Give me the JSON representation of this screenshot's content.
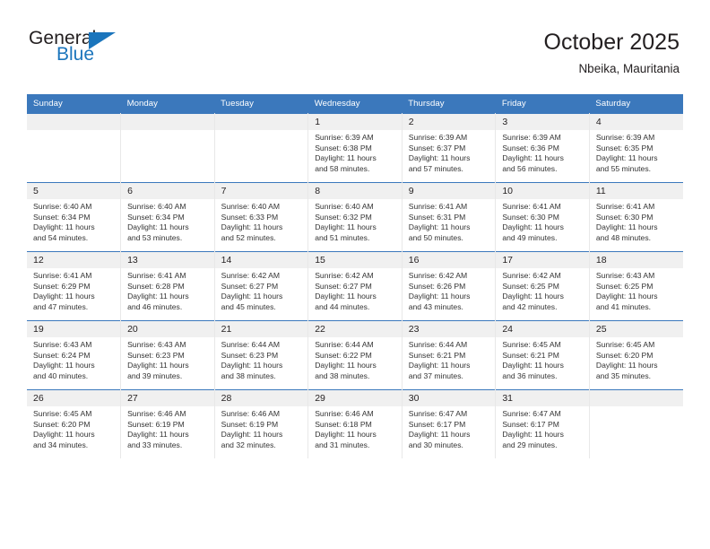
{
  "brand": {
    "name_top": "General",
    "name_bottom": "Blue"
  },
  "header": {
    "title": "October 2025",
    "subtitle": "Nbeika, Mauritania"
  },
  "colors": {
    "header_blue": "#3b78bc",
    "brand_blue": "#1b75bc",
    "daynum_band": "#f0f0f0",
    "text": "#231f20"
  },
  "weekday_headers": [
    "Sunday",
    "Monday",
    "Tuesday",
    "Wednesday",
    "Thursday",
    "Friday",
    "Saturday"
  ],
  "labels": {
    "sunrise_prefix": "Sunrise:",
    "sunset_prefix": "Sunset:",
    "daylight_prefix": "Daylight:"
  },
  "weeks": [
    [
      {
        "day": "",
        "empty": true,
        "l1": "",
        "l2": "",
        "l3": "",
        "l4": ""
      },
      {
        "day": "",
        "empty": true,
        "l1": "",
        "l2": "",
        "l3": "",
        "l4": ""
      },
      {
        "day": "",
        "empty": true,
        "l1": "",
        "l2": "",
        "l3": "",
        "l4": ""
      },
      {
        "day": "1",
        "empty": false,
        "l1": "Sunrise: 6:39 AM",
        "l2": "Sunset: 6:38 PM",
        "l3": "Daylight: 11 hours",
        "l4": "and 58 minutes."
      },
      {
        "day": "2",
        "empty": false,
        "l1": "Sunrise: 6:39 AM",
        "l2": "Sunset: 6:37 PM",
        "l3": "Daylight: 11 hours",
        "l4": "and 57 minutes."
      },
      {
        "day": "3",
        "empty": false,
        "l1": "Sunrise: 6:39 AM",
        "l2": "Sunset: 6:36 PM",
        "l3": "Daylight: 11 hours",
        "l4": "and 56 minutes."
      },
      {
        "day": "4",
        "empty": false,
        "l1": "Sunrise: 6:39 AM",
        "l2": "Sunset: 6:35 PM",
        "l3": "Daylight: 11 hours",
        "l4": "and 55 minutes."
      }
    ],
    [
      {
        "day": "5",
        "empty": false,
        "l1": "Sunrise: 6:40 AM",
        "l2": "Sunset: 6:34 PM",
        "l3": "Daylight: 11 hours",
        "l4": "and 54 minutes."
      },
      {
        "day": "6",
        "empty": false,
        "l1": "Sunrise: 6:40 AM",
        "l2": "Sunset: 6:34 PM",
        "l3": "Daylight: 11 hours",
        "l4": "and 53 minutes."
      },
      {
        "day": "7",
        "empty": false,
        "l1": "Sunrise: 6:40 AM",
        "l2": "Sunset: 6:33 PM",
        "l3": "Daylight: 11 hours",
        "l4": "and 52 minutes."
      },
      {
        "day": "8",
        "empty": false,
        "l1": "Sunrise: 6:40 AM",
        "l2": "Sunset: 6:32 PM",
        "l3": "Daylight: 11 hours",
        "l4": "and 51 minutes."
      },
      {
        "day": "9",
        "empty": false,
        "l1": "Sunrise: 6:41 AM",
        "l2": "Sunset: 6:31 PM",
        "l3": "Daylight: 11 hours",
        "l4": "and 50 minutes."
      },
      {
        "day": "10",
        "empty": false,
        "l1": "Sunrise: 6:41 AM",
        "l2": "Sunset: 6:30 PM",
        "l3": "Daylight: 11 hours",
        "l4": "and 49 minutes."
      },
      {
        "day": "11",
        "empty": false,
        "l1": "Sunrise: 6:41 AM",
        "l2": "Sunset: 6:30 PM",
        "l3": "Daylight: 11 hours",
        "l4": "and 48 minutes."
      }
    ],
    [
      {
        "day": "12",
        "empty": false,
        "l1": "Sunrise: 6:41 AM",
        "l2": "Sunset: 6:29 PM",
        "l3": "Daylight: 11 hours",
        "l4": "and 47 minutes."
      },
      {
        "day": "13",
        "empty": false,
        "l1": "Sunrise: 6:41 AM",
        "l2": "Sunset: 6:28 PM",
        "l3": "Daylight: 11 hours",
        "l4": "and 46 minutes."
      },
      {
        "day": "14",
        "empty": false,
        "l1": "Sunrise: 6:42 AM",
        "l2": "Sunset: 6:27 PM",
        "l3": "Daylight: 11 hours",
        "l4": "and 45 minutes."
      },
      {
        "day": "15",
        "empty": false,
        "l1": "Sunrise: 6:42 AM",
        "l2": "Sunset: 6:27 PM",
        "l3": "Daylight: 11 hours",
        "l4": "and 44 minutes."
      },
      {
        "day": "16",
        "empty": false,
        "l1": "Sunrise: 6:42 AM",
        "l2": "Sunset: 6:26 PM",
        "l3": "Daylight: 11 hours",
        "l4": "and 43 minutes."
      },
      {
        "day": "17",
        "empty": false,
        "l1": "Sunrise: 6:42 AM",
        "l2": "Sunset: 6:25 PM",
        "l3": "Daylight: 11 hours",
        "l4": "and 42 minutes."
      },
      {
        "day": "18",
        "empty": false,
        "l1": "Sunrise: 6:43 AM",
        "l2": "Sunset: 6:25 PM",
        "l3": "Daylight: 11 hours",
        "l4": "and 41 minutes."
      }
    ],
    [
      {
        "day": "19",
        "empty": false,
        "l1": "Sunrise: 6:43 AM",
        "l2": "Sunset: 6:24 PM",
        "l3": "Daylight: 11 hours",
        "l4": "and 40 minutes."
      },
      {
        "day": "20",
        "empty": false,
        "l1": "Sunrise: 6:43 AM",
        "l2": "Sunset: 6:23 PM",
        "l3": "Daylight: 11 hours",
        "l4": "and 39 minutes."
      },
      {
        "day": "21",
        "empty": false,
        "l1": "Sunrise: 6:44 AM",
        "l2": "Sunset: 6:23 PM",
        "l3": "Daylight: 11 hours",
        "l4": "and 38 minutes."
      },
      {
        "day": "22",
        "empty": false,
        "l1": "Sunrise: 6:44 AM",
        "l2": "Sunset: 6:22 PM",
        "l3": "Daylight: 11 hours",
        "l4": "and 38 minutes."
      },
      {
        "day": "23",
        "empty": false,
        "l1": "Sunrise: 6:44 AM",
        "l2": "Sunset: 6:21 PM",
        "l3": "Daylight: 11 hours",
        "l4": "and 37 minutes."
      },
      {
        "day": "24",
        "empty": false,
        "l1": "Sunrise: 6:45 AM",
        "l2": "Sunset: 6:21 PM",
        "l3": "Daylight: 11 hours",
        "l4": "and 36 minutes."
      },
      {
        "day": "25",
        "empty": false,
        "l1": "Sunrise: 6:45 AM",
        "l2": "Sunset: 6:20 PM",
        "l3": "Daylight: 11 hours",
        "l4": "and 35 minutes."
      }
    ],
    [
      {
        "day": "26",
        "empty": false,
        "l1": "Sunrise: 6:45 AM",
        "l2": "Sunset: 6:20 PM",
        "l3": "Daylight: 11 hours",
        "l4": "and 34 minutes."
      },
      {
        "day": "27",
        "empty": false,
        "l1": "Sunrise: 6:46 AM",
        "l2": "Sunset: 6:19 PM",
        "l3": "Daylight: 11 hours",
        "l4": "and 33 minutes."
      },
      {
        "day": "28",
        "empty": false,
        "l1": "Sunrise: 6:46 AM",
        "l2": "Sunset: 6:19 PM",
        "l3": "Daylight: 11 hours",
        "l4": "and 32 minutes."
      },
      {
        "day": "29",
        "empty": false,
        "l1": "Sunrise: 6:46 AM",
        "l2": "Sunset: 6:18 PM",
        "l3": "Daylight: 11 hours",
        "l4": "and 31 minutes."
      },
      {
        "day": "30",
        "empty": false,
        "l1": "Sunrise: 6:47 AM",
        "l2": "Sunset: 6:17 PM",
        "l3": "Daylight: 11 hours",
        "l4": "and 30 minutes."
      },
      {
        "day": "31",
        "empty": false,
        "l1": "Sunrise: 6:47 AM",
        "l2": "Sunset: 6:17 PM",
        "l3": "Daylight: 11 hours",
        "l4": "and 29 minutes."
      },
      {
        "day": "",
        "empty": true,
        "l1": "",
        "l2": "",
        "l3": "",
        "l4": ""
      }
    ]
  ]
}
